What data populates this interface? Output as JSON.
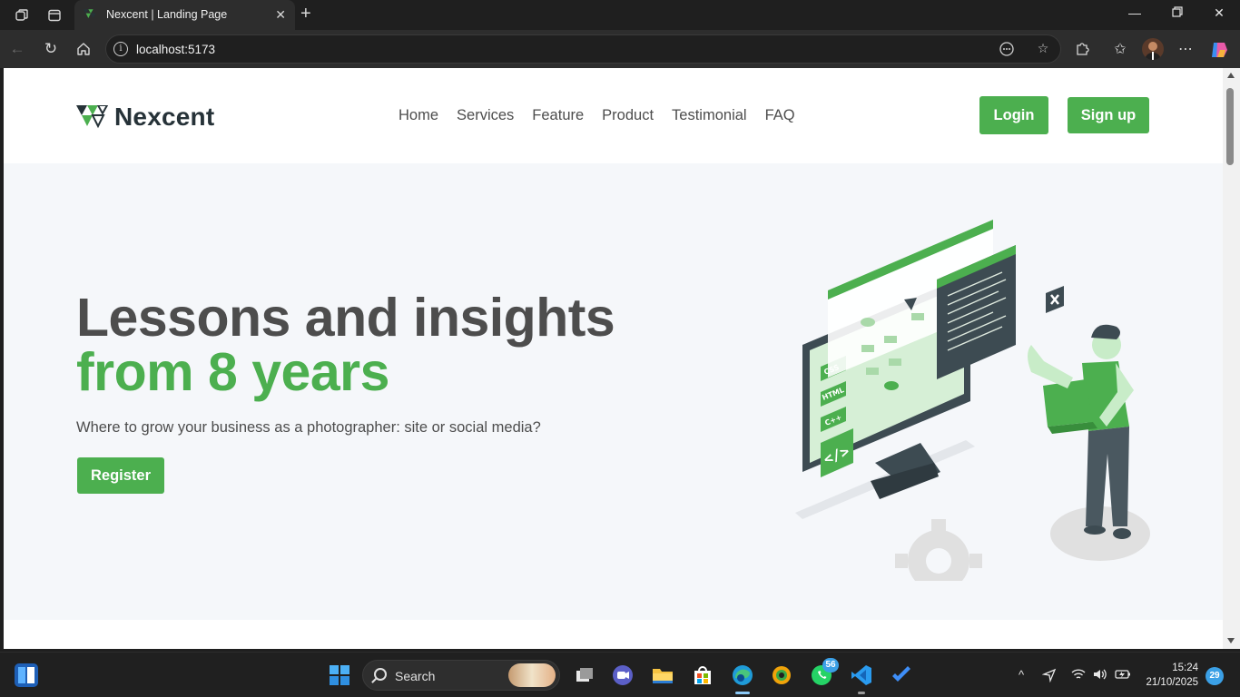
{
  "browser": {
    "tab_title": "Nexcent | Landing Page",
    "url": "localhost:5173"
  },
  "site": {
    "brand": "Nexcent",
    "nav": [
      "Home",
      "Services",
      "Feature",
      "Product",
      "Testimonial",
      "FAQ"
    ],
    "login_label": "Login",
    "signup_label": "Sign up",
    "hero": {
      "title_line1": "Lessons and insights",
      "title_line2": "from 8 years",
      "subtitle": "Where to grow your business as a photographer: site or social media?",
      "register_label": "Register"
    },
    "illustration_labels": [
      "CSS",
      "HTML",
      "C++"
    ],
    "colors": {
      "primary": "#4caf4f",
      "heading": "#4d4d4d",
      "hero_bg": "#f5f7fa"
    }
  },
  "taskbar": {
    "search_placeholder": "Search",
    "whatsapp_badge": "56",
    "time": "15:24",
    "date": "21/10/2025",
    "notifications": "29"
  },
  "icons": [
    "workspaces-icon",
    "tab-actions-icon",
    "back-icon",
    "refresh-icon",
    "home-icon",
    "info-icon",
    "reading-mode-icon",
    "favorite-star-icon",
    "extensions-icon",
    "favorites-icon",
    "profile-avatar",
    "more-icon",
    "copilot-icon",
    "start-icon",
    "search-icon",
    "task-view-icon",
    "file-explorer-icon",
    "store-icon",
    "edge-icon",
    "whatsapp-icon",
    "vscode-icon",
    "todo-icon",
    "wifi-icon",
    "volume-icon",
    "battery-icon"
  ]
}
